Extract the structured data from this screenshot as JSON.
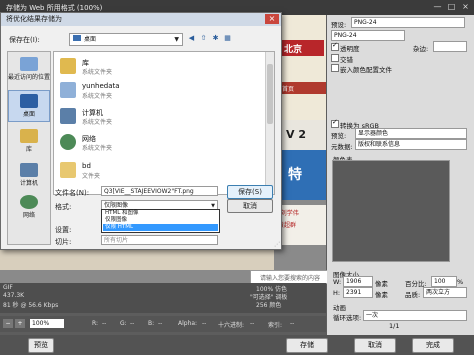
{
  "window": {
    "title": "存储为 Web 所用格式 (100%)",
    "controls": [
      "—",
      "□",
      "×"
    ]
  },
  "dialog": {
    "title": "将优化结果存储为",
    "save_in_label": "保存在(I):",
    "save_in_value": "桌面",
    "places": [
      {
        "label": "最近访问的位置"
      },
      {
        "label": "桌面"
      },
      {
        "label": "库"
      },
      {
        "label": "计算机"
      },
      {
        "label": "网络"
      }
    ],
    "files": [
      {
        "name": "库",
        "type": "系统文件夹"
      },
      {
        "name": "yunhedata",
        "type": "系统文件夹"
      },
      {
        "name": "计算机",
        "type": "系统文件夹"
      },
      {
        "name": "网络",
        "type": "系统文件夹"
      },
      {
        "name": "bd",
        "type": "文件夹"
      }
    ],
    "filename_label": "文件名(N):",
    "filename_value": "Q3[VIE__STAJEEVIOW2\"FT.png",
    "format_label": "格式:",
    "format_value": "仅限图像",
    "settings_label": "设置:",
    "slices_label": "切片:",
    "slices_value": "所有切片",
    "format_options": [
      "HTML 和图像",
      "仅限图像",
      "仅限 HTML"
    ],
    "save_button": "保存(S)",
    "cancel_button": "取消"
  },
  "web_preview": {
    "header_text": "北京",
    "nav_text": "首页",
    "logo_text": "V 2",
    "banner_text": "特",
    "text_lines": [
      "\"刘学伟",
      "黄超群"
    ],
    "search_placeholder": "请输入您要搜索的内容"
  },
  "info_panel": {
    "left_lines": [
      "GIF",
      "437.3K",
      "81 秒 @ 56.6 Kbps"
    ],
    "right_lines": [
      "100% 仿色",
      "\"可选择\" 调板",
      "256 颜色"
    ]
  },
  "zoom_bar": {
    "zoom": "100%",
    "r_label": "R:",
    "g_label": "G:",
    "b_label": "B:",
    "alpha_label": "Alpha:",
    "hex_label": "十六进制:",
    "index_label": "索引:",
    "r_value": "--",
    "g_value": "--",
    "b_value": "--",
    "alpha_value": "--",
    "hex_value": "--",
    "index_value": "--"
  },
  "buttons": {
    "preview": "预览",
    "save": "存储",
    "cancel": "取消",
    "done": "完成"
  },
  "right_panel": {
    "preset_label": "预设:",
    "preset_value": "PNG-24",
    "format_value": "PNG-24",
    "transparency_label": "透明度",
    "transparency_checked": true,
    "matte_label": "杂边:",
    "interlaced_label": "交错",
    "interlaced_checked": false,
    "embed_profile_label": "嵌入颜色配置文件",
    "embed_profile_checked": false,
    "convert_srgb_label": "转换为 sRGB",
    "convert_srgb_checked": true,
    "preview_label": "预览:",
    "preview_value": "显示器颜色",
    "metadata_label": "元数据:",
    "metadata_value": "版权和联系信息",
    "color_table_label": "颜色表",
    "image_size_label": "图像大小",
    "width_label": "W:",
    "width_value": "1906",
    "height_label": "H:",
    "height_value": "2391",
    "unit": "像素",
    "percent_label": "百分比:",
    "percent_value": "100",
    "percent_unit": "%",
    "quality_label": "品质:",
    "quality_value": "两次立方",
    "animation_label": "动画",
    "loop_label": "循环选项:",
    "loop_value": "一次",
    "frame_counter": "1/1"
  },
  "colors": {
    "accent": "#3399ff",
    "dialog_bg": "#f0f0f0",
    "web_red": "#b8262a",
    "web_blue": "#2f6fb5"
  }
}
